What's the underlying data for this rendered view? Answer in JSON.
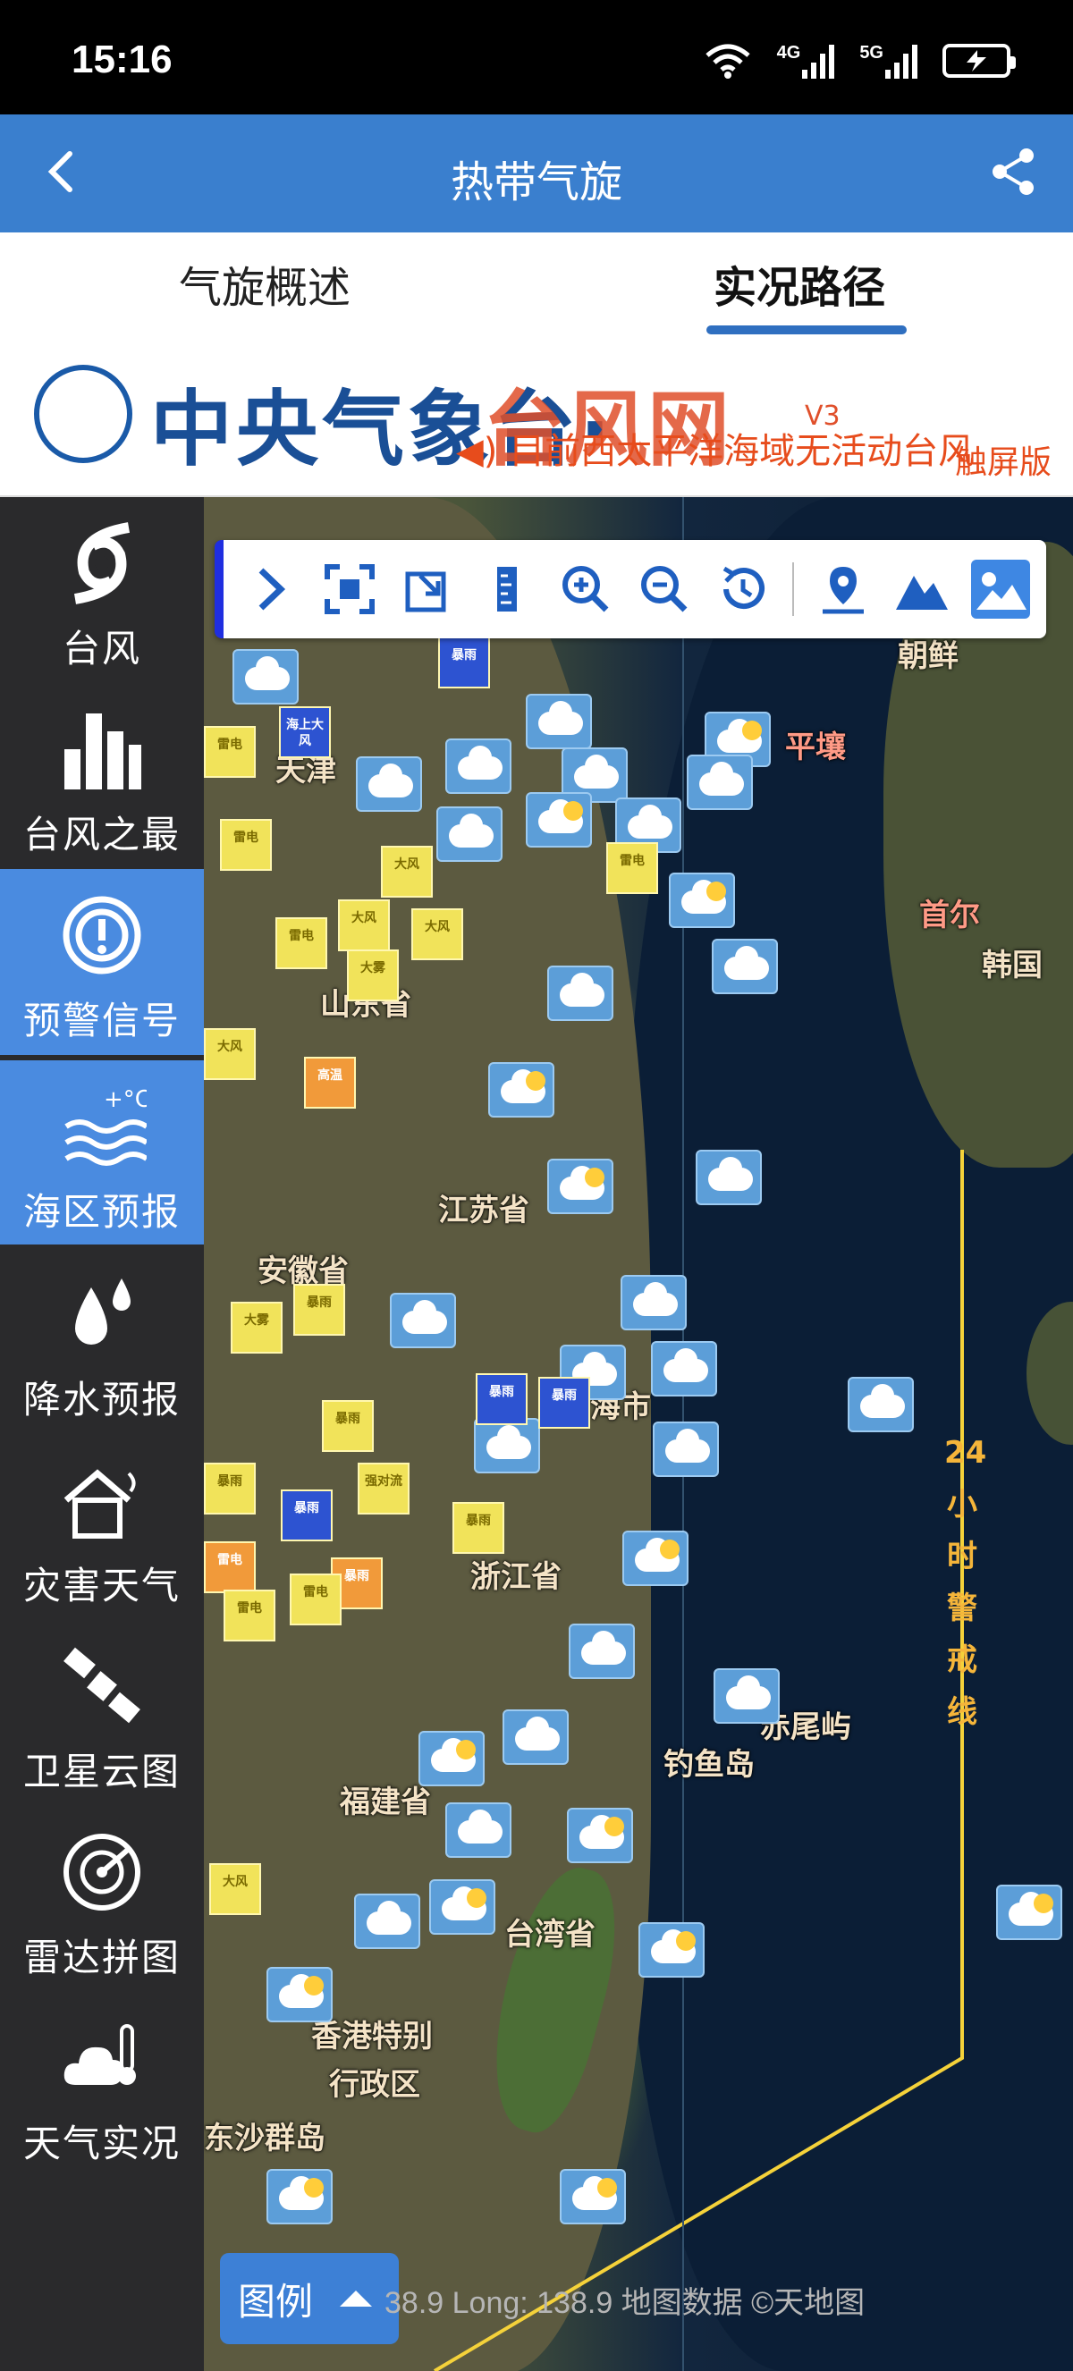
{
  "status_bar": {
    "time": "15:16",
    "net1": "4G",
    "net2": "5G"
  },
  "app_bar": {
    "title": "热带气旋"
  },
  "tabs": [
    {
      "label": "气旋概述",
      "active": false
    },
    {
      "label": "实况路径",
      "active": true
    }
  ],
  "banner": {
    "logo_main": "中央气象台·",
    "logo_red": "台风网",
    "version": "V3",
    "marquee": "目前西太平洋海域无活动台风",
    "touch_version": "触屏版"
  },
  "sidebar": {
    "items": [
      {
        "label": "台风",
        "icon": "typhoon-icon",
        "active": false
      },
      {
        "label": "台风之最",
        "icon": "bar-chart-icon",
        "active": false
      },
      {
        "label": "预警信号",
        "icon": "warning-signal-icon",
        "active": true
      },
      {
        "label": "海区预报",
        "icon": "sea-forecast-icon",
        "active": true
      },
      {
        "label": "降水预报",
        "icon": "raindrop-icon",
        "active": false
      },
      {
        "label": "灾害天气",
        "icon": "disaster-house-icon",
        "active": false
      },
      {
        "label": "卫星云图",
        "icon": "satellite-icon",
        "active": false
      },
      {
        "label": "雷达拼图",
        "icon": "radar-icon",
        "active": false
      },
      {
        "label": "天气实况",
        "icon": "cloud-thermometer-icon",
        "active": false
      }
    ]
  },
  "map": {
    "places": {
      "korea_north": "朝鲜",
      "pyongyang": "平壤",
      "seoul": "首尔",
      "south_korea": "韩国",
      "shandong": "山东省",
      "jiangsu": "江苏省",
      "anhui": "安徽省",
      "shanghai": "海市",
      "zhejiang": "浙江省",
      "fujian": "福建省",
      "taiwan": "台湾省",
      "diaoyu": "钓鱼岛",
      "chiwei": "赤尾屿",
      "hongkong1": "香港特别",
      "hongkong2": "行政区",
      "dongsha": "东沙群岛",
      "tianjin": "天津"
    },
    "warning_line_label": "24小时警戒线",
    "footer": "38.9 Long: 138.9   地图数据 ©天地图",
    "legend_label": "图例"
  },
  "alerts": {
    "thunder": "雷电",
    "wind": "大风",
    "rainstorm": "暴雨",
    "heat": "高温",
    "fog": "大雾",
    "sea_wind": "海上大风",
    "strong_convection": "强对流"
  },
  "colors": {
    "accent": "#3a7fce",
    "sidebar": "#2a2a2c",
    "active_side": "#4a8be0",
    "warning_line": "#f5d23a"
  }
}
